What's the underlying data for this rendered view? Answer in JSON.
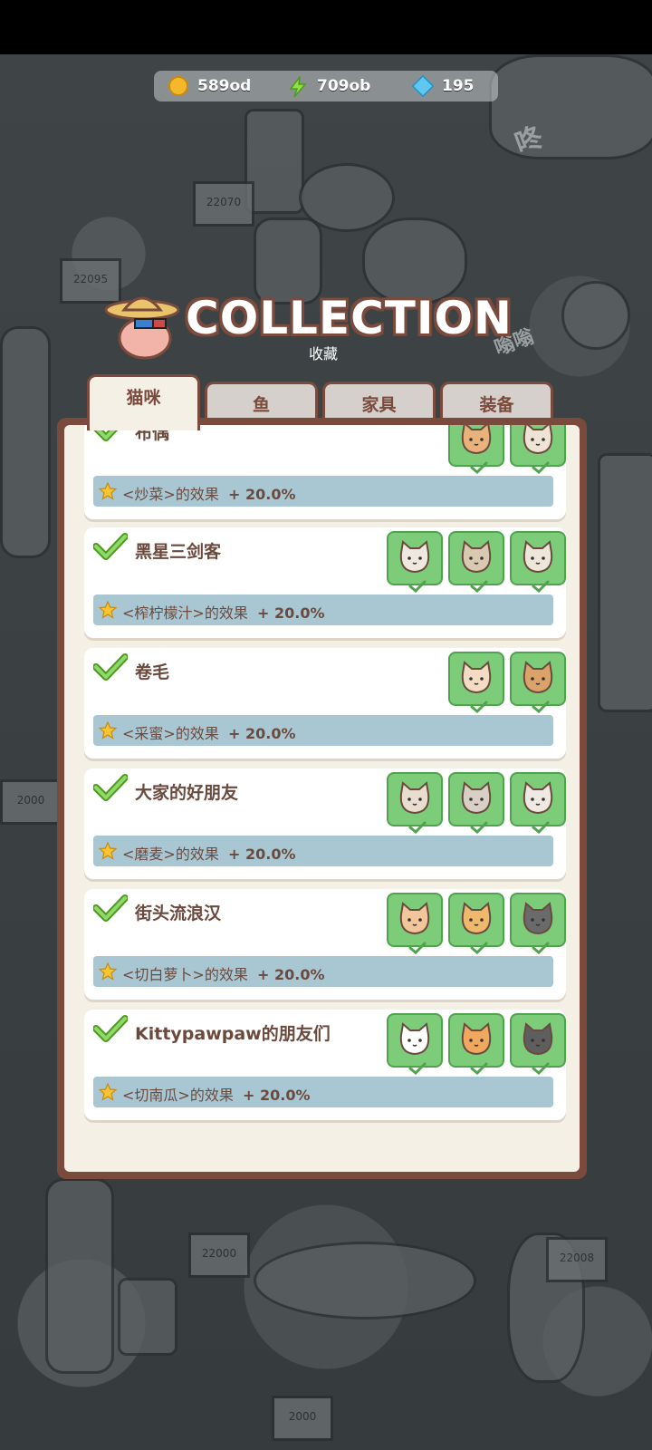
{
  "resources": [
    {
      "icon": "coin-icon",
      "value": "589od"
    },
    {
      "icon": "energy-icon",
      "value": "709ob"
    },
    {
      "icon": "gem-icon",
      "value": "195"
    }
  ],
  "header": {
    "title": "COLLECTION",
    "subtitle": "收藏"
  },
  "tabs": [
    {
      "label": "猫咪",
      "active": true
    },
    {
      "label": "鱼",
      "active": false
    },
    {
      "label": "家具",
      "active": false
    },
    {
      "label": "装备",
      "active": false
    }
  ],
  "background_signs": [
    "22070",
    "22095",
    "2000",
    "22000",
    "22008",
    "2000"
  ],
  "background_text": [
    "咚",
    "嗡嗡"
  ],
  "collections": [
    {
      "name": "布偶",
      "dish": "<炒菜>",
      "effect_label": "的效果",
      "bonus": "+ 20.0%",
      "cats": [
        {
          "color": "#e8b27a"
        },
        {
          "color": "#efe3d6"
        }
      ]
    },
    {
      "name": "黑星三剑客",
      "dish": "<榨柠檬汁>",
      "effect_label": "的效果",
      "bonus": "+ 20.0%",
      "cats": [
        {
          "color": "#eee8de"
        },
        {
          "color": "#d9c9b0"
        },
        {
          "color": "#efe6da"
        }
      ]
    },
    {
      "name": "卷毛",
      "dish": "<采蜜>",
      "effect_label": "的效果",
      "bonus": "+ 20.0%",
      "cats": [
        {
          "color": "#f4dcc4"
        },
        {
          "color": "#dba36a"
        }
      ]
    },
    {
      "name": "大家的好朋友",
      "dish": "<磨麦>",
      "effect_label": "的效果",
      "bonus": "+ 20.0%",
      "cats": [
        {
          "color": "#e9ddd0"
        },
        {
          "color": "#d8cfc6"
        },
        {
          "color": "#eee9e2"
        }
      ]
    },
    {
      "name": "街头流浪汉",
      "dish": "<切白萝卜>",
      "effect_label": "的效果",
      "bonus": "+ 20.0%",
      "cats": [
        {
          "color": "#f2c59a"
        },
        {
          "color": "#f0b86c"
        },
        {
          "color": "#6a6a6a"
        }
      ]
    },
    {
      "name": "Kittypawpaw的朋友们",
      "dish": "<切南瓜>",
      "effect_label": "的效果",
      "bonus": "+ 20.0%",
      "cats": [
        {
          "color": "#ffffff"
        },
        {
          "color": "#f0a860"
        },
        {
          "color": "#5e5e5e"
        }
      ]
    }
  ],
  "colors": {
    "panel_border": "#7a4a3c",
    "panel_bg": "#f5f0e6",
    "bonus_bar": "#a9c7d3",
    "check_green": "#7ccc7a",
    "text_brown": "#6b4a3e"
  }
}
